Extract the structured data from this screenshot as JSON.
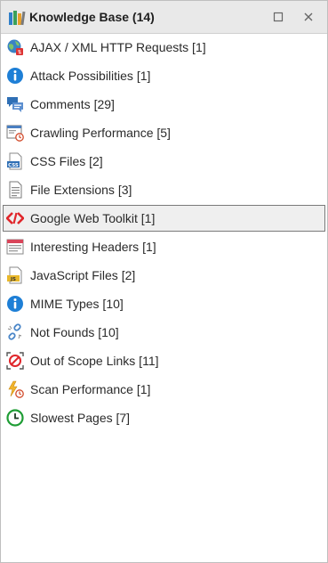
{
  "window": {
    "title": "Knowledge Base (14)"
  },
  "items": [
    {
      "label": "AJAX / XML HTTP Requests [1]",
      "icon": "globe-ajax-icon"
    },
    {
      "label": "Attack Possibilities [1]",
      "icon": "info-icon"
    },
    {
      "label": "Comments [29]",
      "icon": "comments-icon"
    },
    {
      "label": "Crawling Performance [5]",
      "icon": "crawl-performance-icon"
    },
    {
      "label": "CSS Files [2]",
      "icon": "css-file-icon"
    },
    {
      "label": "File Extensions [3]",
      "icon": "document-icon"
    },
    {
      "label": "Google Web Toolkit [1]",
      "icon": "gwt-icon",
      "selected": true
    },
    {
      "label": "Interesting Headers [1]",
      "icon": "headers-icon"
    },
    {
      "label": "JavaScript Files [2]",
      "icon": "js-file-icon"
    },
    {
      "label": "MIME Types [10]",
      "icon": "info-icon"
    },
    {
      "label": "Not Founds [10]",
      "icon": "broken-link-icon"
    },
    {
      "label": "Out of Scope Links [11]",
      "icon": "out-of-scope-icon"
    },
    {
      "label": "Scan Performance [1]",
      "icon": "scan-performance-icon"
    },
    {
      "label": "Slowest Pages [7]",
      "icon": "clock-icon"
    }
  ],
  "colors": {
    "titlebar": "#e9e9e9",
    "selected_bg": "#efefef",
    "selected_border": "#7a7a7a",
    "info_blue": "#1e7fd6",
    "gwt_red": "#e0262b",
    "clock_green": "#1f9d35"
  }
}
